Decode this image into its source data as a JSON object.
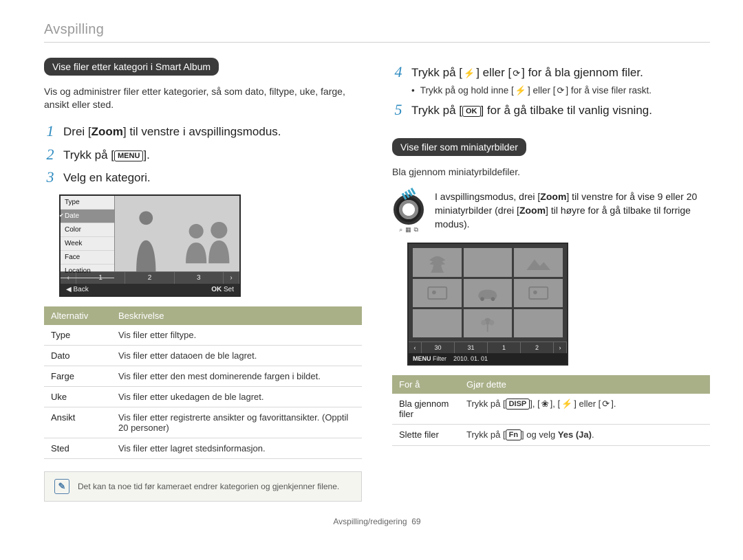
{
  "page": {
    "running_head": "Avspilling",
    "footer": "Avspilling/redigering",
    "page_number": "69"
  },
  "icons": {
    "menu": "MENU",
    "ok": "OK",
    "disp": "DISP",
    "fn": "Fn",
    "flash": "flash-icon",
    "timer": "timer-icon",
    "macro": "macro-icon"
  },
  "left": {
    "heading": "Vise filer etter kategori i Smart Album",
    "intro": "Vis og administrer filer etter kategorier, så som dato, filtype, uke, farge, ansikt eller sted.",
    "steps": [
      {
        "n": "1",
        "pre": "Drei [",
        "bold": "Zoom",
        "post": "] til venstre i avspillingsmodus."
      },
      {
        "n": "2",
        "pre": "Trykk på [",
        "bold": "",
        "post": "].",
        "icon_label": "MENU"
      },
      {
        "n": "3",
        "pre": "Velg en kategori.",
        "bold": "",
        "post": ""
      }
    ],
    "camera_ui": {
      "menu_items": [
        "Type",
        "Date",
        "Color",
        "Week",
        "Face",
        "Location"
      ],
      "selected_index": 1,
      "pager": [
        "1",
        "2",
        "3"
      ],
      "footer_left_sym": "◀",
      "footer_left": "Back",
      "footer_right_sym": "OK",
      "footer_right": "Set"
    },
    "table": {
      "headers": [
        "Alternativ",
        "Beskrivelse"
      ],
      "rows": [
        [
          "Type",
          "Vis filer etter filtype."
        ],
        [
          "Dato",
          "Vis filer etter dataoen de ble lagret."
        ],
        [
          "Farge",
          "Vis filer etter den mest dominerende fargen i bildet."
        ],
        [
          "Uke",
          "Vis filer etter ukedagen de ble lagret."
        ],
        [
          "Ansikt",
          "Vis filer etter registrerte ansikter og favorittansikter. (Opptil 20 personer)"
        ],
        [
          "Sted",
          "Vis filer etter lagret stedsinformasjon."
        ]
      ]
    },
    "note": "Det kan ta noe tid før kameraet endrer kategorien og gjenkjenner filene."
  },
  "right": {
    "steps": [
      {
        "n": "4",
        "parts": [
          "Trykk på [",
          "] eller [",
          "] for å bla gjennom filer."
        ],
        "iconsyms": [
          "flash",
          "timer"
        ],
        "sub": {
          "parts": [
            "Trykk på og hold inne [",
            "] eller [",
            "] for å vise filer raskt."
          ],
          "iconsyms": [
            "flash",
            "timer"
          ]
        }
      },
      {
        "n": "5",
        "parts": [
          "Trykk på [",
          "] for å gå tilbake til vanlig visning."
        ],
        "icon_labels": [
          "OK"
        ]
      }
    ],
    "heading2": "Vise filer som miniatyrbilder",
    "intro2": "Bla gjennom miniatyrbildefiler.",
    "dial_text": {
      "pre": "I avspillingsmodus, drei [",
      "b1": "Zoom",
      "mid": "] til venstre for å vise 9 eller 20 miniatyrbilder (drei [",
      "b2": "Zoom",
      "post": "] til høyre for å gå tilbake til forrige modus)."
    },
    "grid_ui": {
      "pager": [
        "30",
        "31",
        "1",
        "2"
      ],
      "footer_menu_sym": "MENU",
      "footer_menu": "Filter",
      "footer_date": "2010. 01. 01"
    },
    "table2": {
      "headers": [
        "For å",
        "Gjør dette"
      ],
      "rows": [
        {
          "c1": "Bla gjennom filer",
          "c2": {
            "pre": "Trykk på [",
            "labels": [
              "DISP"
            ],
            "mid1": "], [",
            "syms": [
              "macro",
              "flash",
              "timer"
            ],
            "end": "]."
          }
        },
        {
          "c1": "Slette filer",
          "c2": {
            "pre": "Trykk på [",
            "labels": [
              "Fn"
            ],
            "mid": "] og velg ",
            "bold": "Yes (Ja)",
            "end": "."
          }
        }
      ]
    }
  }
}
